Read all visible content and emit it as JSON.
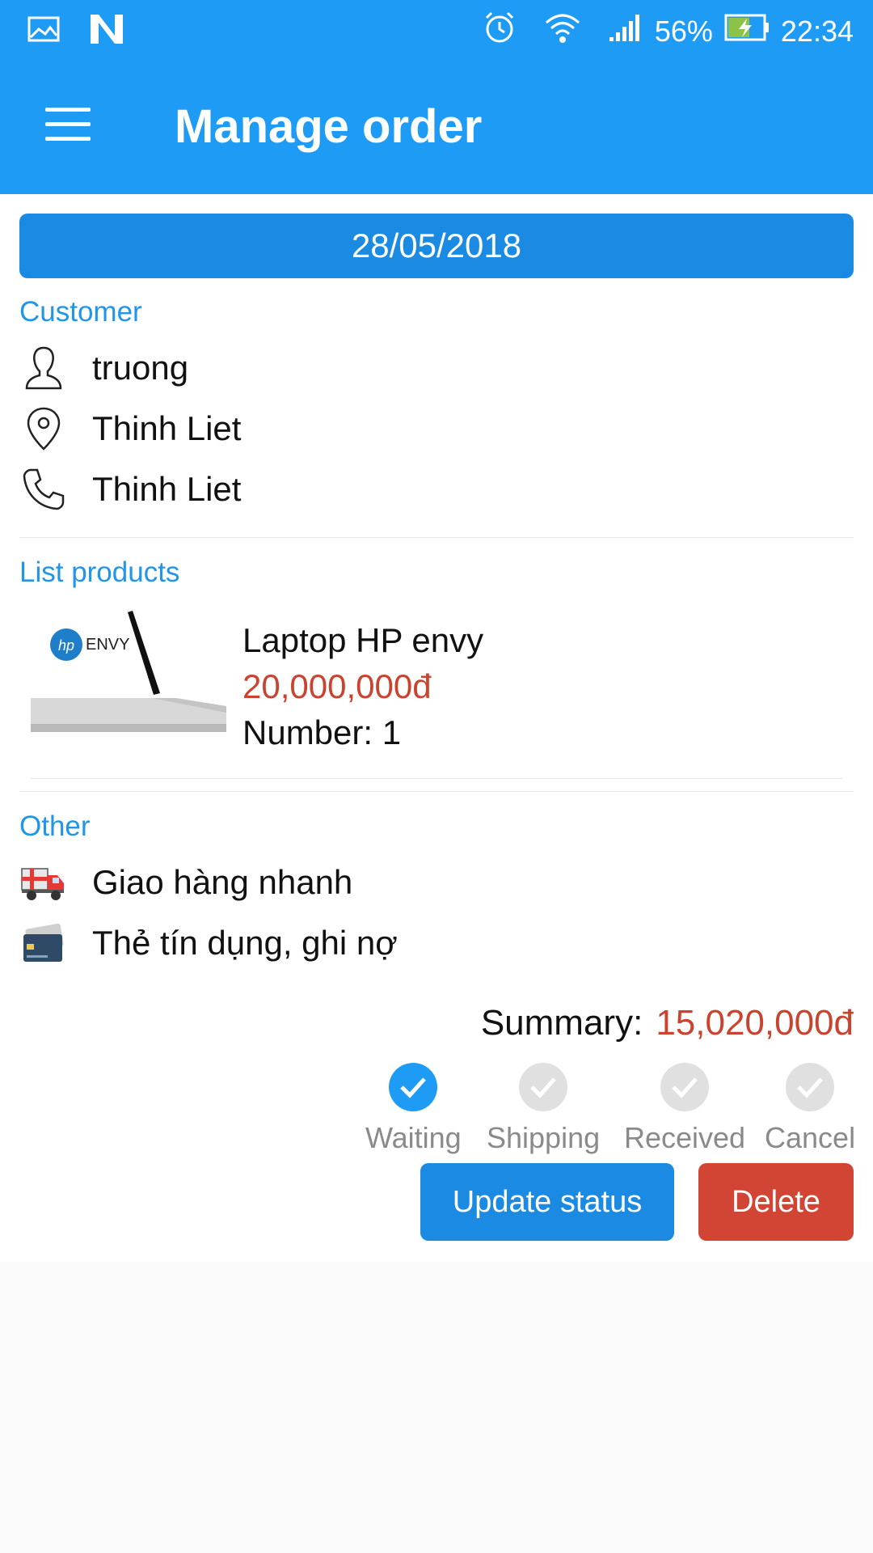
{
  "status_bar": {
    "battery": "56%",
    "time": "22:34"
  },
  "app_bar": {
    "title": "Manage order"
  },
  "order": {
    "date": "28/05/2018"
  },
  "customer": {
    "section_label": "Customer",
    "name": "truong",
    "address": "Thinh Liet",
    "phone": "Thinh Liet"
  },
  "products": {
    "section_label": "List products",
    "items": [
      {
        "name": "Laptop HP envy",
        "price": "20,000,000đ",
        "number": "Number: 1",
        "image_brand": "ENVY"
      }
    ]
  },
  "other": {
    "section_label": "Other",
    "shipping": "Giao hàng nhanh",
    "payment": "Thẻ tín dụng, ghi nợ"
  },
  "summary": {
    "label": "Summary:",
    "value": "15,020,000đ"
  },
  "statuses": [
    {
      "label": "Waiting",
      "selected": true
    },
    {
      "label": "Shipping",
      "selected": false
    },
    {
      "label": "Received",
      "selected": false
    },
    {
      "label": "Cancel",
      "selected": false
    }
  ],
  "actions": {
    "update": "Update status",
    "delete": "Delete"
  },
  "colors": {
    "primary": "#1e9bf5",
    "accent_label": "#2196e8",
    "price": "#c9432f",
    "delete": "#d24433"
  }
}
